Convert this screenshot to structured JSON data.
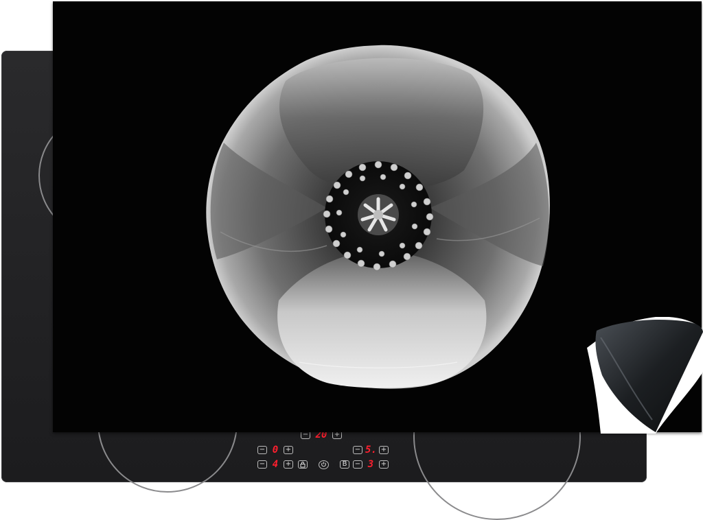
{
  "image": {
    "subject": "black-and-white-poppy-induction-hob-cover",
    "colors": {
      "mat": "#030303",
      "hob": "#1f1f21",
      "display": "#ff1f2e",
      "petal_light": "#e8e8e8",
      "petal_dark": "#4a4a4a"
    }
  },
  "controls": {
    "top_display": "20",
    "left_top_display": "0",
    "left_bottom_display": "4",
    "right_top_display": "5.",
    "right_bottom_display": "3",
    "minus": "−",
    "plus": "+",
    "lock_icon": "lock-icon",
    "power_icon": "power-icon",
    "boost_label": "B"
  }
}
